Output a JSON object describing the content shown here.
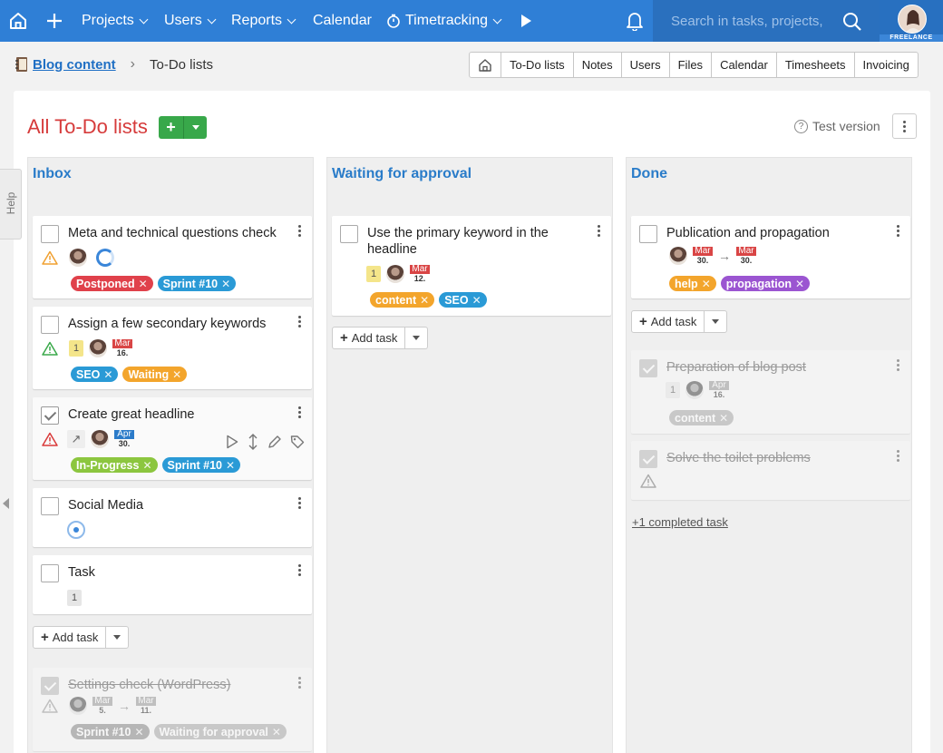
{
  "nav": {
    "projects": "Projects",
    "users": "Users",
    "reports": "Reports",
    "calendar": "Calendar",
    "timetracking": "Timetracking",
    "search_placeholder": "Search in tasks, projects, u",
    "avatar_badge": "FREELANCE"
  },
  "breadcrumb": {
    "project": "Blog content",
    "current": "To-Do lists"
  },
  "toolbar": [
    "To-Do lists",
    "Notes",
    "Users",
    "Files",
    "Calendar",
    "Timesheets",
    "Invoicing"
  ],
  "page": {
    "title": "All To-Do lists",
    "test_version": "Test version",
    "help": "Help"
  },
  "columns": {
    "inbox": {
      "title": "Inbox",
      "add_task": "Add task",
      "cards": [
        {
          "title": "Meta and technical questions check",
          "tags": [
            "Postponed",
            "Sprint #10"
          ]
        },
        {
          "title": "Assign a few secondary keywords",
          "num": "1",
          "date": {
            "month": "Mar",
            "day": "16."
          },
          "tags": [
            "SEO",
            "Waiting"
          ]
        },
        {
          "title": "Create great headline",
          "date": {
            "month": "Apr",
            "day": "30."
          },
          "tags": [
            "In-Progress",
            "Sprint #10"
          ]
        },
        {
          "title": "Social Media"
        },
        {
          "title": "Task",
          "num": "1"
        },
        {
          "title": "Settings check (WordPress)",
          "date_from": {
            "month": "Mar",
            "day": "5."
          },
          "date_to": {
            "month": "Mar",
            "day": "11."
          },
          "tags": [
            "Sprint #10",
            "Waiting for approval"
          ]
        }
      ]
    },
    "waiting": {
      "title": "Waiting for approval",
      "add_task": "Add task",
      "cards": [
        {
          "title": "Use the primary keyword in the headline",
          "num": "1",
          "date": {
            "month": "Mar",
            "day": "12."
          },
          "tags": [
            "content",
            "SEO"
          ]
        }
      ]
    },
    "done": {
      "title": "Done",
      "add_task": "Add task",
      "more_link": "+1 completed task",
      "cards": [
        {
          "title": "Publication and propagation",
          "date_from": {
            "month": "Mar",
            "day": "30."
          },
          "date_to": {
            "month": "Mar",
            "day": "30."
          },
          "tags": [
            "help",
            "propagation"
          ]
        },
        {
          "title": "Preparation of blog post",
          "num": "1",
          "date": {
            "month": "Apr",
            "day": "16."
          },
          "tags": [
            "content"
          ]
        },
        {
          "title": "Solve the toilet problems"
        }
      ]
    }
  },
  "colors": {
    "topbar": "#2f7fd6",
    "title": "#d63b3b",
    "column_heading": "#2a7cc9",
    "tag_red": "#e0414b",
    "tag_blue": "#2a9ad6",
    "tag_orange": "#f3a52c",
    "tag_green": "#8cc63f",
    "tag_purple": "#9b55d1",
    "tag_grey": "#b5b5b5"
  }
}
